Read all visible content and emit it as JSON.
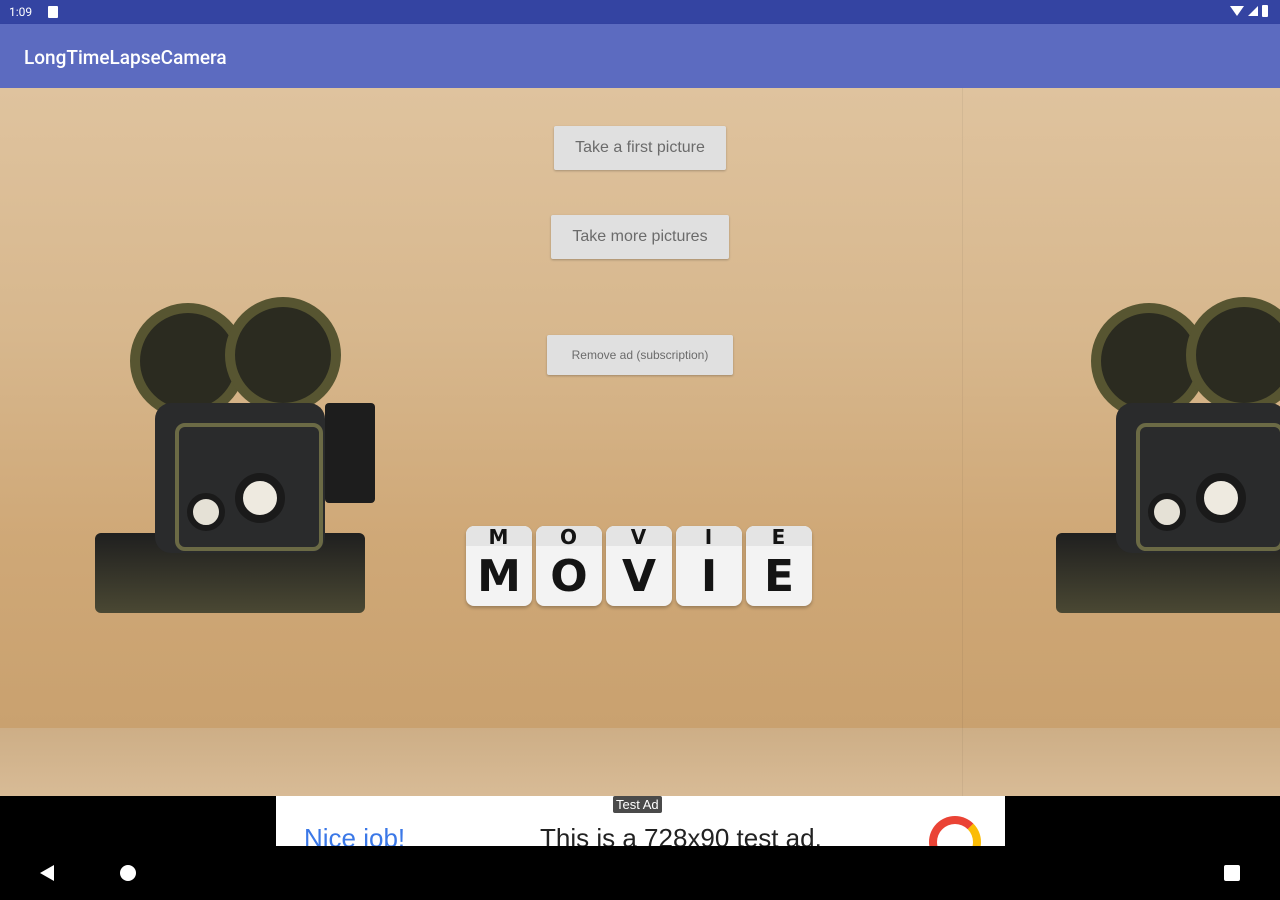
{
  "status_bar": {
    "time": "1:09",
    "icons": [
      "sd-card-icon",
      "wifi-icon",
      "signal-icon",
      "battery-icon"
    ]
  },
  "app_bar": {
    "title": "LongTimeLapseCamera"
  },
  "content": {
    "background_image": "movie-projector-and-letter-dice-on-cork",
    "dice_letters_top": [
      "M",
      "O",
      "V",
      "I",
      "E"
    ],
    "dice_letters_front": [
      "M",
      "O",
      "V",
      "I",
      "E"
    ],
    "buttons": {
      "first_picture": "Take a first picture",
      "more_pictures": "Take more pictures",
      "remove_ad": "Remove ad (subscription)"
    }
  },
  "ad": {
    "label": "Test Ad",
    "headline": "Nice job!",
    "body": "This is a 728x90 test ad."
  },
  "nav_bar": {
    "icons": [
      "back-icon",
      "home-icon",
      "recents-icon"
    ]
  },
  "colors": {
    "status_bar": "#3444a2",
    "app_bar": "#5c6bc0",
    "button_bg": "#e0e0e0",
    "ad_headline": "#3b78e7"
  }
}
